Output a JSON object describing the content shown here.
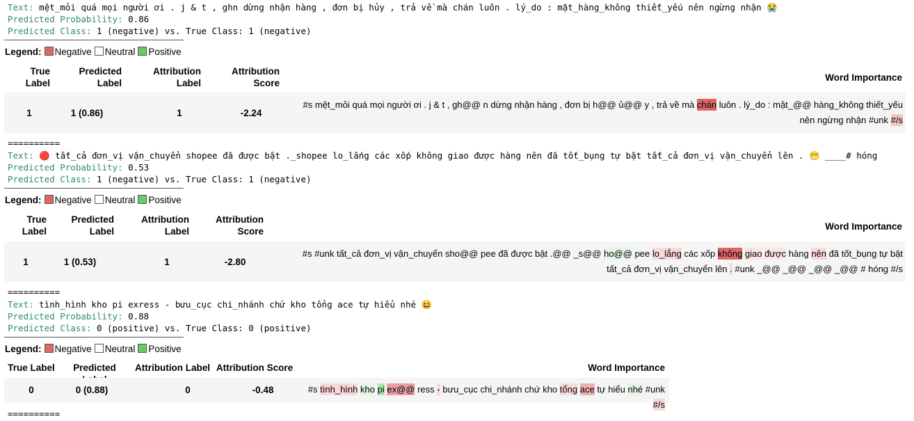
{
  "legend": {
    "title": "Legend:",
    "items": [
      "Negative",
      "Neutral",
      "Positive"
    ],
    "colors": [
      "#e06666",
      "#ffffff",
      "#66cc66"
    ]
  },
  "headers": {
    "true_label": "True Label",
    "predicted_label": "Predicted Label",
    "attribution_label": "Attribution Label",
    "attribution_score": "Attribution Score",
    "word_importance": "Word Importance"
  },
  "separator": "==========",
  "records": [
    {
      "text_key": "Text:",
      "text": "mệt_mỏi quá mọi người ơi . j & t , ghn dừng nhận hàng , đơn bị hủy , trả về mà chán luôn . lý_do : mặt_hàng_không thiết_yếu nên ngừng nhận 😭",
      "prob_key": "Predicted Probability:",
      "prob": "0.86",
      "class_key": "Predicted Class:",
      "class": "1 (negative) vs. True Class: 1 (negative)",
      "true_label": "1",
      "predicted_label": "1 (0.86)",
      "attribution_label": "1",
      "attribution_score": "-2.24",
      "words": [
        {
          "t": "#s",
          "c": ""
        },
        {
          "t": "mệt_mỏi",
          "c": ""
        },
        {
          "t": "quá",
          "c": ""
        },
        {
          "t": "mọi",
          "c": ""
        },
        {
          "t": "người",
          "c": ""
        },
        {
          "t": "ơi",
          "c": ""
        },
        {
          "t": ".",
          "c": ""
        },
        {
          "t": "j",
          "c": ""
        },
        {
          "t": "&",
          "c": ""
        },
        {
          "t": "t",
          "c": ""
        },
        {
          "t": ",",
          "c": ""
        },
        {
          "t": "gh@@",
          "c": ""
        },
        {
          "t": "n",
          "c": ""
        },
        {
          "t": "dừng",
          "c": ""
        },
        {
          "t": "nhận",
          "c": ""
        },
        {
          "t": "hàng",
          "c": ""
        },
        {
          "t": ",",
          "c": ""
        },
        {
          "t": "đơn",
          "c": ""
        },
        {
          "t": "bị",
          "c": ""
        },
        {
          "t": "h@@",
          "c": ""
        },
        {
          "t": "ủ@@",
          "c": ""
        },
        {
          "t": "y",
          "c": ""
        },
        {
          "t": ",",
          "c": ""
        },
        {
          "t": "trả",
          "c": ""
        },
        {
          "t": "về",
          "c": ""
        },
        {
          "t": "mà",
          "c": ""
        },
        {
          "t": "chán",
          "c": "#e06666"
        },
        {
          "t": "luôn",
          "c": ""
        },
        {
          "t": ".",
          "c": ""
        },
        {
          "t": "lý_do",
          "c": ""
        },
        {
          "t": ":",
          "c": ""
        },
        {
          "t": "mặt_@@",
          "c": ""
        },
        {
          "t": "hàng_không",
          "c": ""
        },
        {
          "t": "thiết_yếu",
          "c": ""
        },
        {
          "t": "nên",
          "c": ""
        },
        {
          "t": "ngừng",
          "c": ""
        },
        {
          "t": "nhận",
          "c": ""
        },
        {
          "t": "#unk",
          "c": ""
        },
        {
          "t": "#/s",
          "c": "#f6c6c6"
        }
      ]
    },
    {
      "text_key": "Text:",
      "text": "🔴 tất_cả đơn_vị vận_chuyển shopee đã được bật ._shopee lo_lắng các xốp không giao được hàng nên đã tốt_bụng tự bật tất_cả đơn_vị vận_chuyển lên . 😁 ____# hóng",
      "prob_key": "Predicted Probability:",
      "prob": "0.53",
      "class_key": "Predicted Class:",
      "class": "1 (negative) vs. True Class: 1 (negative)",
      "true_label": "1",
      "predicted_label": "1 (0.53)",
      "attribution_label": "1",
      "attribution_score": "-2.80",
      "words": [
        {
          "t": "#s",
          "c": ""
        },
        {
          "t": "#unk",
          "c": ""
        },
        {
          "t": "tất_cả",
          "c": ""
        },
        {
          "t": "đơn_vị",
          "c": ""
        },
        {
          "t": "vận_chuyển",
          "c": ""
        },
        {
          "t": "sho@@",
          "c": ""
        },
        {
          "t": "pee",
          "c": ""
        },
        {
          "t": "đã",
          "c": ""
        },
        {
          "t": "được",
          "c": ""
        },
        {
          "t": "bật",
          "c": ""
        },
        {
          "t": ".@@",
          "c": ""
        },
        {
          "t": "_s@@",
          "c": ""
        },
        {
          "t": "ho@@",
          "c": "#e6f6e6"
        },
        {
          "t": "pee",
          "c": ""
        },
        {
          "t": "lo_lắng",
          "c": "#f8d8d8"
        },
        {
          "t": "các",
          "c": ""
        },
        {
          "t": "xốp",
          "c": ""
        },
        {
          "t": "không",
          "c": "#e06666"
        },
        {
          "t": "giao",
          "c": "#fbe4e4"
        },
        {
          "t": "được",
          "c": "#fbe4e4"
        },
        {
          "t": "hàng",
          "c": ""
        },
        {
          "t": "nên",
          "c": "#f8d8d8"
        },
        {
          "t": "đã",
          "c": ""
        },
        {
          "t": "tốt_bụng",
          "c": ""
        },
        {
          "t": "tự",
          "c": ""
        },
        {
          "t": "bật",
          "c": ""
        },
        {
          "t": "tất_cả",
          "c": ""
        },
        {
          "t": "đơn_vị",
          "c": ""
        },
        {
          "t": "vận_chuyển",
          "c": ""
        },
        {
          "t": "lên",
          "c": ""
        },
        {
          "t": ".",
          "c": "#f8d8d8"
        },
        {
          "t": "#unk",
          "c": ""
        },
        {
          "t": "_@@",
          "c": ""
        },
        {
          "t": "_@@",
          "c": ""
        },
        {
          "t": "_@@",
          "c": ""
        },
        {
          "t": "_@@",
          "c": ""
        },
        {
          "t": "#",
          "c": ""
        },
        {
          "t": "hóng",
          "c": ""
        },
        {
          "t": "#/s",
          "c": ""
        }
      ]
    },
    {
      "text_key": "Text:",
      "text": "tình_hình kho pi exress - bưu_cục chi_nhánh chứ kho tổng ace tự hiểu nhé 😆",
      "prob_key": "Predicted Probability:",
      "prob": "0.88",
      "class_key": "Predicted Class:",
      "class": "0 (positive) vs. True Class: 0 (positive)",
      "true_label": "0",
      "predicted_label": "0 (0.88)",
      "attribution_label": "0",
      "attribution_score": "-0.48",
      "words": [
        {
          "t": "#s",
          "c": ""
        },
        {
          "t": "tình_hình",
          "c": "#f8d8d8"
        },
        {
          "t": "kho",
          "c": "#e6f6e6"
        },
        {
          "t": "pi",
          "c": "#a8e8a8"
        },
        {
          "t": "ex@@",
          "c": "#eaa0a0"
        },
        {
          "t": "ress",
          "c": ""
        },
        {
          "t": "-",
          "c": "#f8d8d8"
        },
        {
          "t": "bưu_cục",
          "c": ""
        },
        {
          "t": "chi_nhánh",
          "c": ""
        },
        {
          "t": "chứ",
          "c": ""
        },
        {
          "t": "kho",
          "c": ""
        },
        {
          "t": "tổng",
          "c": "#f8d8d8"
        },
        {
          "t": "ace",
          "c": "#eeb0b0"
        },
        {
          "t": "tự",
          "c": ""
        },
        {
          "t": "hiểu",
          "c": ""
        },
        {
          "t": "nhé",
          "c": "#e6f6e6"
        },
        {
          "t": "#unk",
          "c": ""
        },
        {
          "t": "#/s",
          "c": "#f8d8d8"
        }
      ]
    }
  ]
}
